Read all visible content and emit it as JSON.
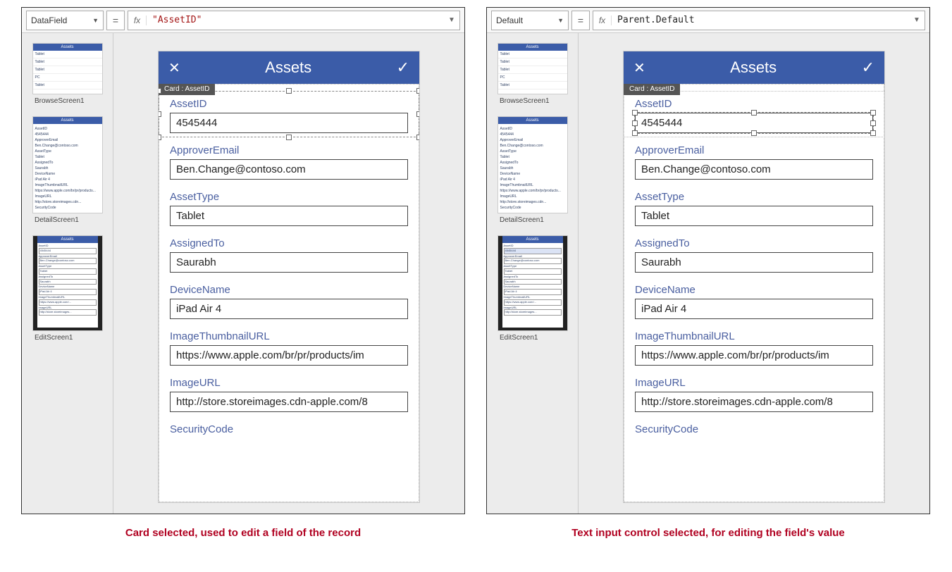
{
  "formula_bar": {
    "left": {
      "property": "DataField",
      "fx_label": "fx",
      "value": "\"AssetID\""
    },
    "right": {
      "property": "Default",
      "fx_label": "fx",
      "value": "Parent.Default"
    },
    "equals": "="
  },
  "thumbs": {
    "browse": {
      "title": "Assets",
      "items": [
        "Tablet",
        "Tablet",
        "Tablet",
        "PC",
        "Tablet"
      ],
      "label": "BrowseScreen1"
    },
    "detail": {
      "title": "Assets",
      "label": "DetailScreen1"
    },
    "edit": {
      "title": "Assets",
      "label": "EditScreen1"
    }
  },
  "phone": {
    "title": "Assets",
    "badge": "Card : AssetID",
    "fields": [
      {
        "label": "AssetID",
        "value": "4545444"
      },
      {
        "label": "ApproverEmail",
        "value": "Ben.Change@contoso.com"
      },
      {
        "label": "AssetType",
        "value": "Tablet"
      },
      {
        "label": "AssignedTo",
        "value": "Saurabh"
      },
      {
        "label": "DeviceName",
        "value": "iPad Air 4"
      },
      {
        "label": "ImageThumbnailURL",
        "value": "https://www.apple.com/br/pr/products/im"
      },
      {
        "label": "ImageURL",
        "value": "http://store.storeimages.cdn-apple.com/8"
      },
      {
        "label": "SecurityCode",
        "value": ""
      }
    ]
  },
  "captions": {
    "left": "Card selected, used to edit a field of the record",
    "right": "Text input control selected, for editing the field's value"
  }
}
